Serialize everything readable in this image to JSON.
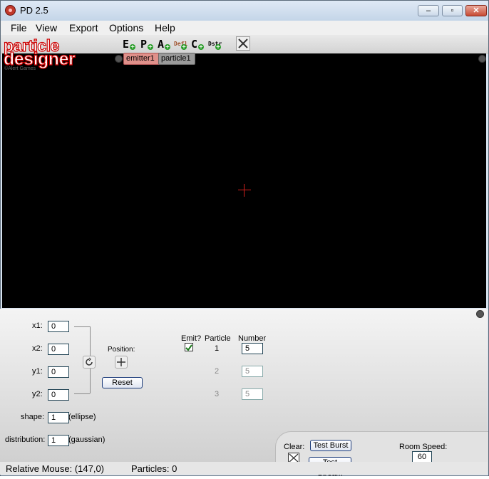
{
  "window": {
    "title": "PD 2.5"
  },
  "menu": [
    "File",
    "View",
    "Export",
    "Options",
    "Help"
  ],
  "logo": {
    "line1": "particle",
    "line2": "designer",
    "credit": "©Alert Games"
  },
  "toolbar": {
    "buttons": [
      {
        "letter": "E",
        "icon": "add-emitter-icon"
      },
      {
        "letter": "P",
        "icon": "add-particle-icon"
      },
      {
        "letter": "A",
        "icon": "add-attractor-icon"
      },
      {
        "letter": "Defl",
        "icon": "add-deflector-icon"
      },
      {
        "letter": "C",
        "icon": "add-changer-icon"
      },
      {
        "letter": "Dstr",
        "icon": "add-destroyer-icon"
      }
    ]
  },
  "tabs": [
    "emitter1",
    "particle1"
  ],
  "colors": {
    "emitter_tab": "#e0908a",
    "particle_tab": "#9a9a9a",
    "canvas": "#000000",
    "crosshair": "#d0201c"
  },
  "emitter": {
    "x1_label": "x1:",
    "x1": "0",
    "x2_label": "x2:",
    "x2": "0",
    "y1_label": "y1:",
    "y1": "0",
    "y2_label": "y2:",
    "y2": "0",
    "position_label": "Position:",
    "reset_label": "Reset",
    "shape_label": "shape:",
    "shape": "1",
    "shape_name": "(ellipse)",
    "distribution_label": "distribution:",
    "distribution": "1",
    "distribution_name": "(gaussian)"
  },
  "particles_table": {
    "headers": [
      "Emit?",
      "Particle",
      "Number"
    ],
    "rows": [
      {
        "emit": true,
        "particle": "1",
        "number": "5"
      },
      {
        "emit": false,
        "particle": "2",
        "number": "5"
      },
      {
        "emit": false,
        "particle": "3",
        "number": "5"
      }
    ]
  },
  "controls": {
    "clear_label": "Clear:",
    "test_burst_label": "Test Burst",
    "test_stream_label": "Test Stream",
    "room_speed_label": "Room Speed:",
    "room_speed": "60"
  },
  "status": {
    "relative_mouse": "Relative Mouse:  (147,0)",
    "particles": "Particles: 0"
  }
}
